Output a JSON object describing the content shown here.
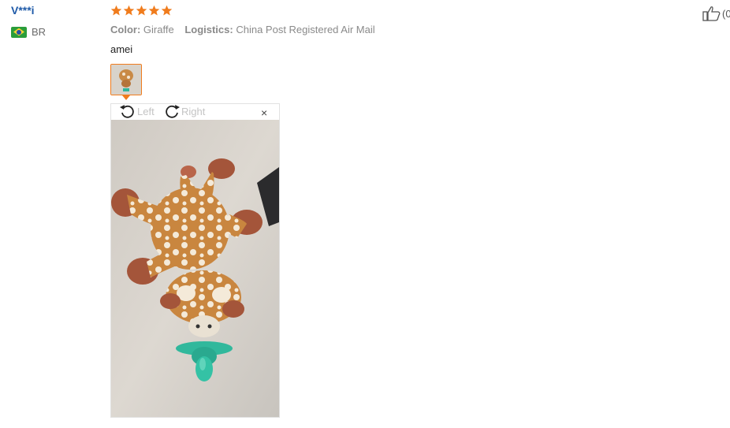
{
  "user": {
    "name": "V***i",
    "country_code": "BR",
    "flag_icon": "brazil-flag-icon"
  },
  "review": {
    "rating": 5,
    "rating_max": 5,
    "star_color": "#f07c1d",
    "attributes": [
      {
        "label": "Color:",
        "value": "Giraffe"
      },
      {
        "label": "Logistics:",
        "value": "China Post Registered Air Mail"
      }
    ],
    "comment": "amei"
  },
  "viewer": {
    "rotate_left_label": "Left",
    "rotate_right_label": "Right",
    "close_glyph": "×",
    "photo_subject": "giraffe plush pacifier toy"
  },
  "helpful": {
    "icon": "thumbs-up-icon",
    "count_text": "(0"
  },
  "colors": {
    "username": "#1e5aa8",
    "accent": "#f07c1d"
  }
}
